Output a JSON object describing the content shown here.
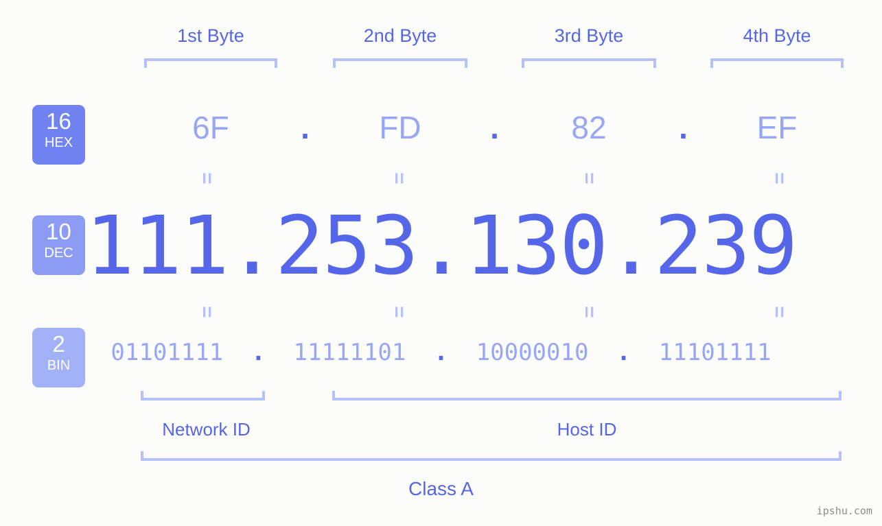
{
  "meta": {
    "watermark": "ipshu.com",
    "background_color": "#fcfdfb",
    "accent_color": "#5566e8",
    "accent_light_color": "#97a6f5",
    "bracket_color": "#b6c0fb"
  },
  "byte_headers": [
    {
      "label": "1st Byte"
    },
    {
      "label": "2nd Byte"
    },
    {
      "label": "3rd Byte"
    },
    {
      "label": "4th Byte"
    }
  ],
  "bases": [
    {
      "number": "16",
      "name": "HEX",
      "color": "#7083f0"
    },
    {
      "number": "10",
      "name": "DEC",
      "color": "#8c9cf5"
    },
    {
      "number": "2",
      "name": "BIN",
      "color": "#a3b1f8"
    }
  ],
  "separator": ".",
  "equals_symbol": "=",
  "rows": {
    "hex": {
      "values": [
        "6F",
        "FD",
        "82",
        "EF"
      ]
    },
    "dec": {
      "text": "111.253.130.239",
      "values": [
        "111",
        "253",
        "130",
        "239"
      ]
    },
    "bin": {
      "values": [
        "01101111",
        "11111101",
        "10000010",
        "11101111"
      ],
      "text": "01101111 . 11111101 . 10000010 . 11101111"
    }
  },
  "id_sections": [
    {
      "label": "Network ID"
    },
    {
      "label": "Host ID"
    }
  ],
  "class": {
    "label": "Class A"
  }
}
